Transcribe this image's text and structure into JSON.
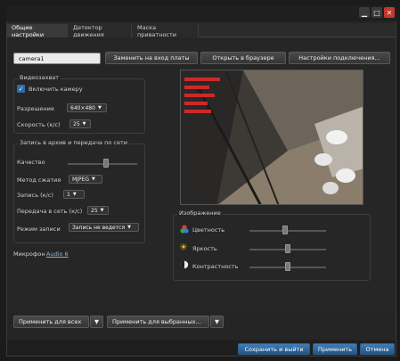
{
  "tabs": [
    {
      "label": "Общие настройки",
      "active": true
    },
    {
      "label": "Детектор движения",
      "active": false
    },
    {
      "label": "Маска приватности",
      "active": false
    }
  ],
  "camera": {
    "name": "camera1",
    "replace_button": "Заменить на вход платы",
    "browser_button": "Открыть в браузере",
    "connection_button": "Настройки подключения..."
  },
  "capture": {
    "title": "Видеозахват",
    "enable_label": "Включить камеру",
    "enabled": true,
    "resolution_label": "Разрешение",
    "resolution_value": "640×480",
    "speed_label": "Скорость (к/с)",
    "speed_value": "25"
  },
  "record": {
    "title": "Запись в архив и передача по сети",
    "quality_label": "Качество",
    "quality_level": 0.55,
    "method_label": "Метод сжатия",
    "method_value": "MJPEG",
    "record_label": "Запись (к/с)",
    "record_value": "1",
    "network_label": "Передача в сеть (к/с)",
    "network_value": "25",
    "mode_label": "Режим записи",
    "mode_value": "Запись не ведется"
  },
  "microphone": {
    "label": "Микрофон",
    "link": "Audio 6"
  },
  "image": {
    "title": "Изображение",
    "color_label": "Цветность",
    "color_level": 0.47,
    "brightness_label": "Яркость",
    "brightness_level": 0.5,
    "contrast_label": "Контрастность",
    "contrast_level": 0.5
  },
  "apply": {
    "all_label": "Применить для всех",
    "selected_label": "Применить для выбранных..."
  },
  "footer": {
    "save_exit": "Сохранить и выйти",
    "apply": "Применить",
    "cancel": "Отмена"
  },
  "colors": {
    "accent": "#2f6ca3",
    "close": "#c0392b"
  }
}
